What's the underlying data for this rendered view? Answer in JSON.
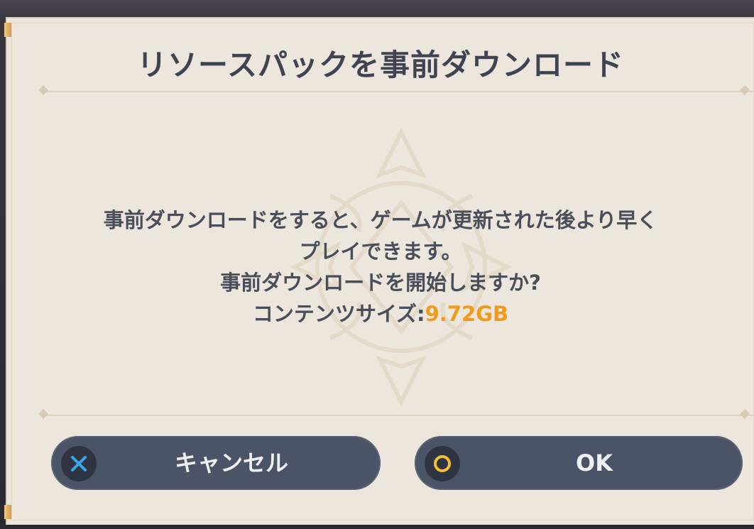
{
  "dialog": {
    "title": "リソースパックを事前ダウンロード",
    "message_line1": "事前ダウンロードをすると、ゲームが更新された後より早く",
    "message_line2": "プレイできます。",
    "message_line3": "事前ダウンロードを開始しますか?",
    "content_size_label": "コンテンツサイズ:",
    "content_size_value": "9.72GB"
  },
  "buttons": {
    "cancel_label": "キャンセル",
    "cancel_icon": "cross-icon",
    "ok_label": "OK",
    "ok_icon": "circle-icon"
  },
  "colors": {
    "dialog_background": "#ece6dc",
    "title_text": "#3f4352",
    "body_text": "#4a4d5a",
    "accent": "#f09a1e",
    "button_background": "#4b5366",
    "cross_icon": "#3aa7e6",
    "circle_icon": "#f2c232"
  }
}
